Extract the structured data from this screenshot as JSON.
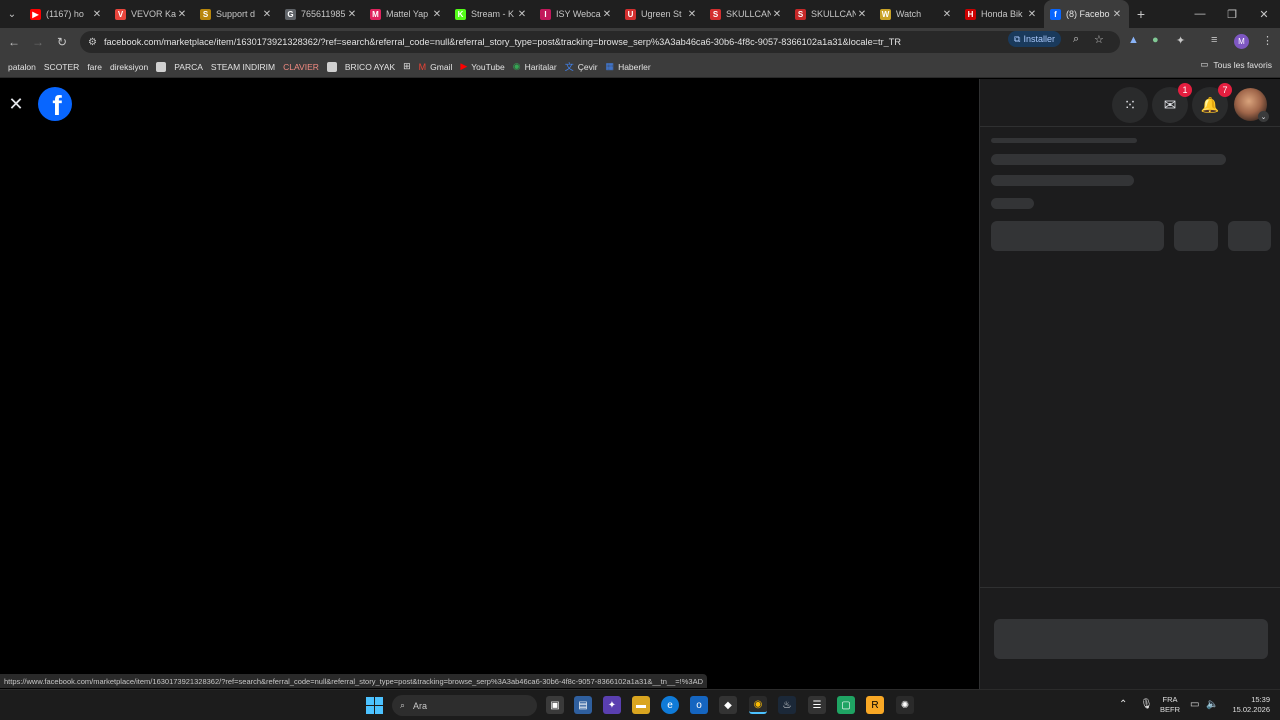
{
  "browser": {
    "tabs": [
      {
        "title": "(1167) ho",
        "favicon_color": "#ff0000",
        "favicon_glyph": "▶"
      },
      {
        "title": "VEVOR Ka",
        "favicon_color": "#e8453c",
        "favicon_glyph": "V"
      },
      {
        "title": "Support d",
        "favicon_color": "#b8860b",
        "favicon_glyph": "S"
      },
      {
        "title": "765611985",
        "favicon_color": "#5f6368",
        "favicon_glyph": "G"
      },
      {
        "title": "Mattel Yap",
        "favicon_color": "#e0245e",
        "favicon_glyph": "M"
      },
      {
        "title": "Stream - K",
        "favicon_color": "#53fc18",
        "favicon_glyph": "K"
      },
      {
        "title": "ISY Webca",
        "favicon_color": "#c2185b",
        "favicon_glyph": "I"
      },
      {
        "title": "Ugreen St",
        "favicon_color": "#d32f2f",
        "favicon_glyph": "U"
      },
      {
        "title": "SKULLCAN",
        "favicon_color": "#d32f2f",
        "favicon_glyph": "S"
      },
      {
        "title": "SKULLCAN",
        "favicon_color": "#c62828",
        "favicon_glyph": "S"
      },
      {
        "title": "Watch",
        "favicon_color": "#c9a227",
        "favicon_glyph": "W"
      },
      {
        "title": "Honda Bik",
        "favicon_color": "#cc0000",
        "favicon_glyph": "H"
      },
      {
        "title": "(8) Facebo",
        "favicon_color": "#0866ff",
        "favicon_glyph": "f",
        "active": true
      }
    ],
    "url": "facebook.com/marketplace/item/1630173921328362/?ref=search&referral_code=null&referral_story_type=post&tracking=browse_serp%3A3ab46ca6-30b6-4f8c-9057-8366102a1a31&locale=tr_TR",
    "install_label": "Installer",
    "profile_initial": "M",
    "bookmarks": [
      {
        "label": "patalon",
        "style": "plain"
      },
      {
        "label": "SCOTER",
        "style": "plain"
      },
      {
        "label": "fare",
        "style": "plain"
      },
      {
        "label": "direksiyon",
        "style": "plain"
      },
      {
        "label": "",
        "style": "square"
      },
      {
        "label": "PARCA",
        "style": "plain"
      },
      {
        "label": "STEAM INDIRIM",
        "style": "plain"
      },
      {
        "label": "CLAVIER",
        "style": "red"
      },
      {
        "label": "",
        "style": "square"
      },
      {
        "label": "BRICO AYAK",
        "style": "plain"
      }
    ],
    "bookmarks_apps": [
      {
        "label": "Gmail",
        "icon": "gmail-icon"
      },
      {
        "label": "YouTube",
        "icon": "youtube-icon"
      },
      {
        "label": "Haritalar",
        "icon": "maps-icon"
      },
      {
        "label": "Çevir",
        "icon": "translate-icon"
      },
      {
        "label": "Haberler",
        "icon": "news-icon"
      }
    ],
    "all_bookmarks_label": "Tous les favoris",
    "status_url": "https://www.facebook.com/marketplace/item/1630173921328362/?ref=search&referral_code=null&referral_story_type=post&tracking=browse_serp%3A3ab46ca6-30b6-4f8c-9057-8366102a1a31&__tn__=!%3AD"
  },
  "facebook": {
    "messenger_badge": "1",
    "notifications_badge": "7",
    "brand_color": "#0866ff"
  },
  "taskbar": {
    "search_placeholder": "Ara",
    "lang_top": "FRA",
    "lang_bottom": "BEFR",
    "time": "15:39",
    "date": "15.02.2026"
  }
}
